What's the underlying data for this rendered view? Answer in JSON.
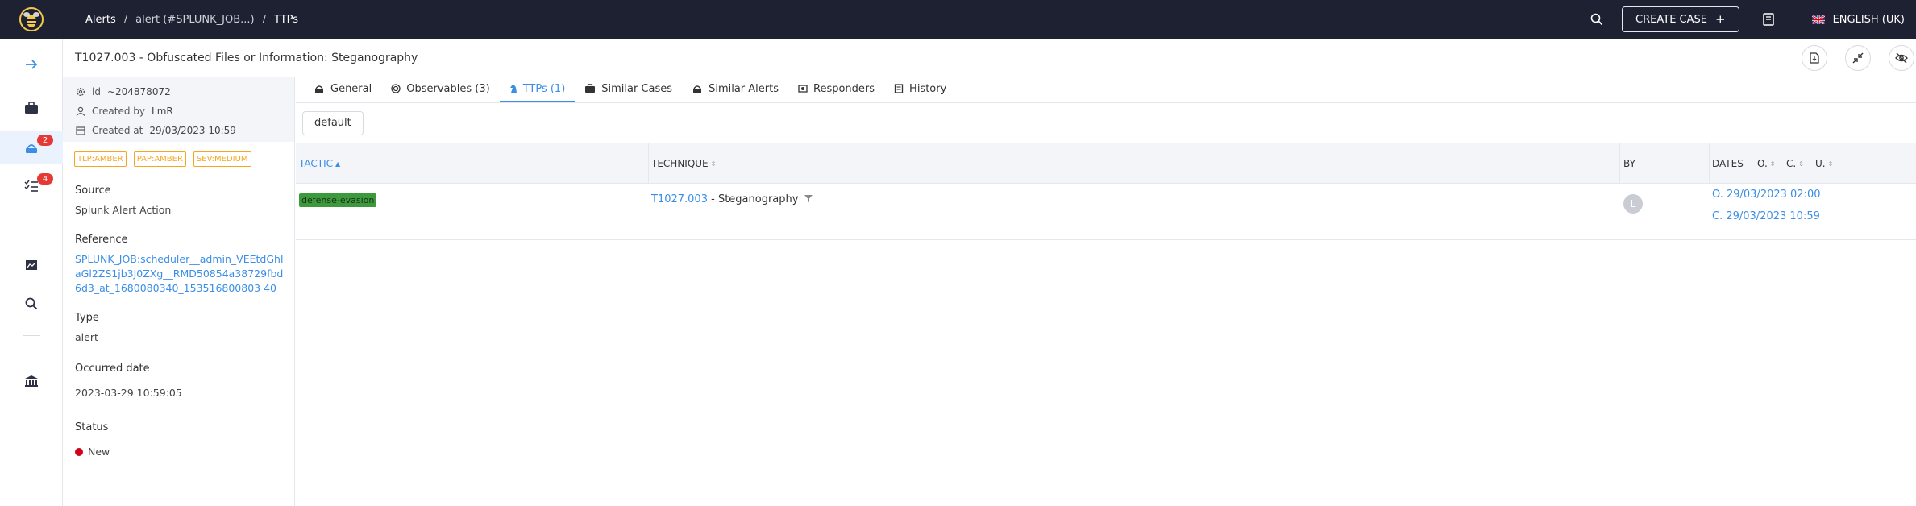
{
  "header": {
    "breadcrumb": [
      "Alerts",
      "alert (#SPLUNK_JOB...)",
      "TTPs"
    ],
    "create_case_label": "CREATE CASE",
    "language_label": "ENGLISH (UK)"
  },
  "nav": {
    "badges": {
      "alerts": "2",
      "tasks": "4"
    }
  },
  "page": {
    "title": "T1027.003 - Obfuscated Files or Information: Steganography"
  },
  "details": {
    "id_label": "id",
    "id_value": "~204878072",
    "created_by_label": "Created by",
    "created_by_value": "LmR",
    "created_at_label": "Created at",
    "created_at_value": "29/03/2023 10:59",
    "tags": [
      "TLP:AMBER",
      "PAP:AMBER",
      "SEV:MEDIUM"
    ],
    "source_label": "Source",
    "source_value": "Splunk Alert Action",
    "reference_label": "Reference",
    "reference_value": "SPLUNK_JOB:scheduler__admin_VEEtdGhlaGl2ZS1jb3J0ZXg__RMD50854a38729fbd6d3_at_1680080340_153516800803 40",
    "type_label": "Type",
    "type_value": "alert",
    "occurred_label": "Occurred date",
    "occurred_value": "2023-03-29 10:59:05",
    "status_label": "Status",
    "status_value": "New"
  },
  "tabs": [
    "General",
    "Observables (3)",
    "TTPs (1)",
    "Similar Cases",
    "Similar Alerts",
    "Responders",
    "History"
  ],
  "toolbar": {
    "default_label": "default"
  },
  "table": {
    "headers": {
      "tactic": "TACTIC",
      "technique": "TECHNIQUE",
      "by": "BY",
      "dates": "DATES",
      "o": "O.",
      "c": "C.",
      "u": "U."
    },
    "row": {
      "tactic": "defense-evasion",
      "technique_id": "T1027.003",
      "technique_name": " - Steganography",
      "by_initial": "L",
      "date_o": "O. 29/03/2023 02:00",
      "date_c": "C. 29/03/2023 10:59"
    }
  },
  "colors": {
    "topbar": "#1e2131",
    "accent": "#3a8ee6",
    "tag": "#f5a623",
    "tactic": "#3c9a3c",
    "badge": "#e53935",
    "status_new": "#d0021b"
  }
}
